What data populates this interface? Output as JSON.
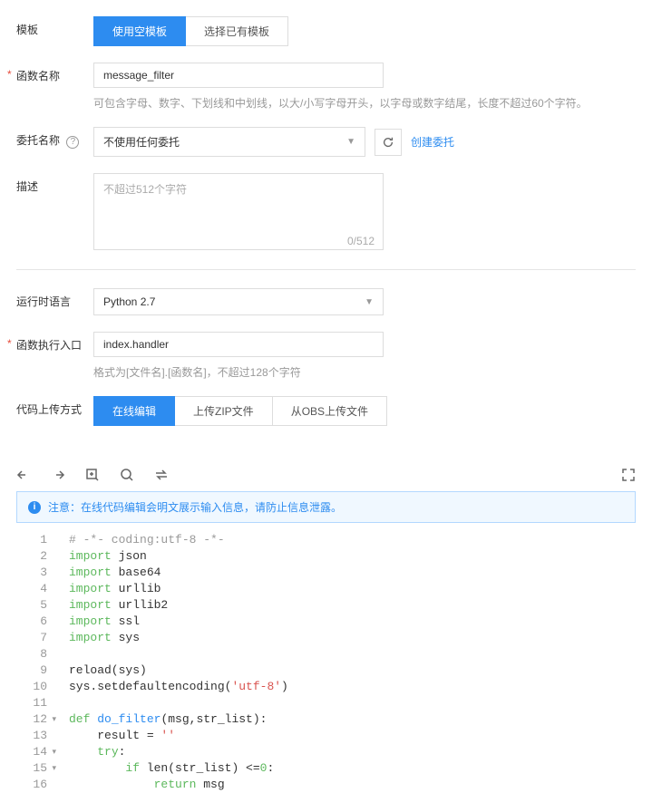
{
  "labels": {
    "template": "模板",
    "functionName": "函数名称",
    "delegationName": "委托名称",
    "description": "描述",
    "runtimeLanguage": "运行时语言",
    "handler": "函数执行入口",
    "uploadMethod": "代码上传方式"
  },
  "template": {
    "emptyTemplate": "使用空模板",
    "existingTemplate": "选择已有模板"
  },
  "functionName": {
    "value": "message_filter",
    "help": "可包含字母、数字、下划线和中划线，以大/小写字母开头，以字母或数字结尾，长度不超过60个字符。"
  },
  "delegation": {
    "value": "不使用任何委托",
    "createLink": "创建委托"
  },
  "description": {
    "placeholder": "不超过512个字符",
    "counter": "0/512"
  },
  "runtime": {
    "value": "Python 2.7"
  },
  "handler": {
    "value": "index.handler",
    "help": "格式为[文件名].[函数名]，不超过128个字符"
  },
  "uploadMethod": {
    "onlineEdit": "在线编辑",
    "uploadZip": "上传ZIP文件",
    "fromObs": "从OBS上传文件"
  },
  "notice": "注意：在线代码编辑会明文展示输入信息，请防止信息泄露。",
  "code": {
    "lines": [
      {
        "n": "1",
        "fold": false,
        "html": "<span class='c-comment'># -*- coding:utf-8 -*-</span>"
      },
      {
        "n": "2",
        "fold": false,
        "html": "<span class='c-keyword'>import</span> json"
      },
      {
        "n": "3",
        "fold": false,
        "html": "<span class='c-keyword'>import</span> base64"
      },
      {
        "n": "4",
        "fold": false,
        "html": "<span class='c-keyword'>import</span> urllib"
      },
      {
        "n": "5",
        "fold": false,
        "html": "<span class='c-keyword'>import</span> urllib2"
      },
      {
        "n": "6",
        "fold": false,
        "html": "<span class='c-keyword'>import</span> ssl"
      },
      {
        "n": "7",
        "fold": false,
        "html": "<span class='c-keyword'>import</span> sys"
      },
      {
        "n": "8",
        "fold": false,
        "html": ""
      },
      {
        "n": "9",
        "fold": false,
        "html": "reload(sys)"
      },
      {
        "n": "10",
        "fold": false,
        "html": "sys.setdefaultencoding(<span class='c-string'>'utf-8'</span>)"
      },
      {
        "n": "11",
        "fold": false,
        "html": ""
      },
      {
        "n": "12",
        "fold": true,
        "html": "<span class='c-keyword'>def</span> <span class='c-def'>do_filter</span>(msg,str_list):"
      },
      {
        "n": "13",
        "fold": false,
        "html": "    result = <span class='c-string'>''</span>"
      },
      {
        "n": "14",
        "fold": true,
        "html": "    <span class='c-keyword'>try</span>:"
      },
      {
        "n": "15",
        "fold": true,
        "html": "        <span class='c-keyword'>if</span> len(str_list) &lt;=<span class='c-number'>0</span>:"
      },
      {
        "n": "16",
        "fold": false,
        "html": "            <span class='c-keyword'>return</span> msg"
      }
    ]
  }
}
